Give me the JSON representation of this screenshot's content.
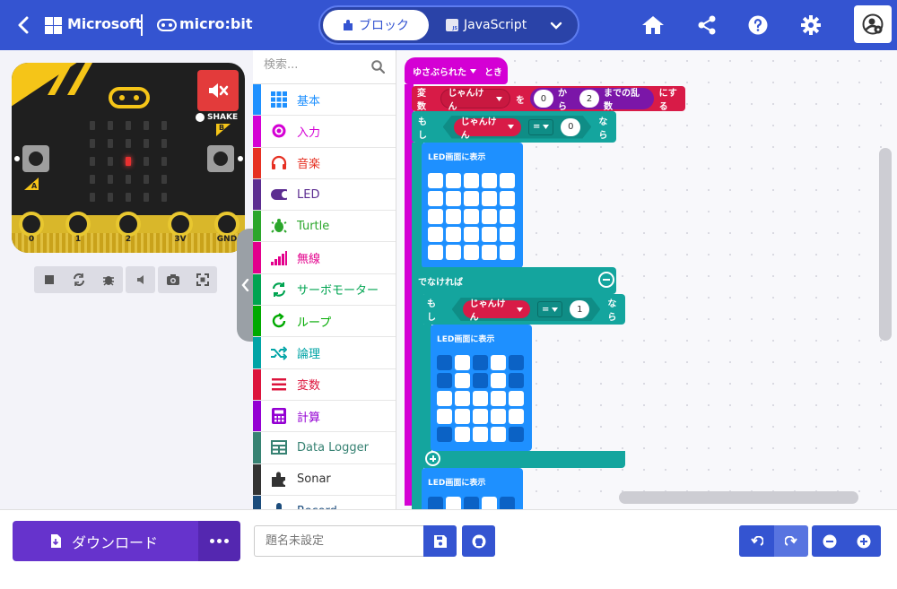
{
  "header": {
    "brand": "Microsoft",
    "product": "micro:bit",
    "mode_blocks": "ブロック",
    "mode_js": "JavaScript"
  },
  "simulator": {
    "shake_label": "SHAKE",
    "button_a": "A",
    "button_b": "B",
    "pins": [
      "0",
      "1",
      "2",
      "3V",
      "GND"
    ],
    "led_on": [
      [
        0,
        0,
        0,
        0,
        0
      ],
      [
        0,
        0,
        0,
        0,
        0
      ],
      [
        0,
        0,
        1,
        0,
        0
      ],
      [
        0,
        0,
        0,
        0,
        0
      ],
      [
        0,
        0,
        0,
        0,
        0
      ]
    ]
  },
  "toolbox": {
    "search_placeholder": "検索...",
    "categories": [
      {
        "label": "基本",
        "color": "#1e90ff",
        "icon": "grid-icon"
      },
      {
        "label": "入力",
        "color": "#d400d4",
        "icon": "target-icon"
      },
      {
        "label": "音楽",
        "color": "#e63022",
        "icon": "headphones-icon"
      },
      {
        "label": "LED",
        "color": "#5c2d91",
        "icon": "toggle-icon"
      },
      {
        "label": "Turtle",
        "color": "#2ba62b",
        "icon": "turtle-icon"
      },
      {
        "label": "無線",
        "color": "#e3008c",
        "icon": "signal-bars-icon"
      },
      {
        "label": "サーボモーター",
        "color": "#00a451",
        "icon": "refresh-icon"
      },
      {
        "label": "ループ",
        "color": "#00aa00",
        "icon": "loop-icon"
      },
      {
        "label": "論理",
        "color": "#00a4a6",
        "icon": "shuffle-icon"
      },
      {
        "label": "変数",
        "color": "#dc143c",
        "icon": "lines-icon"
      },
      {
        "label": "計算",
        "color": "#9400d3",
        "icon": "calculator-icon"
      },
      {
        "label": "Data Logger",
        "color": "#378273",
        "icon": "table-icon"
      },
      {
        "label": "Sonar",
        "color": "#333333",
        "icon": "puzzle-icon"
      },
      {
        "label": "Record",
        "color": "#1c4c7c",
        "icon": "mic-icon"
      }
    ]
  },
  "workspace": {
    "event_label": "ゆさぶられた",
    "event_suffix": "とき",
    "set_var_label": "変数",
    "var_name": "じゃんけん",
    "to_label": "を",
    "rand_from": "0",
    "rand_from_label": "から",
    "rand_to": "2",
    "rand_to_label": "までの乱数",
    "set_suffix": "にする",
    "if_label": "もし",
    "eq_op": "=",
    "if_value": "0",
    "then_label": "なら",
    "show_leds": "LED画面に表示",
    "else_label": "でなければ",
    "else_if_value": "1",
    "leds1": [
      [
        1,
        1,
        1,
        1,
        1
      ],
      [
        1,
        1,
        1,
        1,
        1
      ],
      [
        1,
        1,
        1,
        1,
        1
      ],
      [
        1,
        1,
        1,
        1,
        1
      ],
      [
        1,
        1,
        1,
        1,
        1
      ]
    ],
    "leds2": [
      [
        0,
        1,
        0,
        1,
        0
      ],
      [
        0,
        1,
        0,
        1,
        0
      ],
      [
        1,
        1,
        1,
        1,
        1
      ],
      [
        1,
        1,
        1,
        1,
        1
      ],
      [
        0,
        1,
        1,
        1,
        0
      ]
    ]
  },
  "bottom": {
    "download_label": "ダウンロード",
    "project_name_placeholder": "題名未設定"
  }
}
